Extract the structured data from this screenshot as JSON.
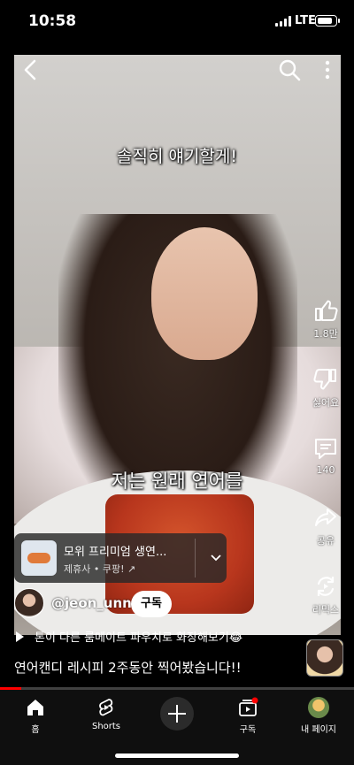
{
  "status_bar": {
    "time": "10:58",
    "network": "LTE",
    "battery_level": 0.85
  },
  "video": {
    "caption_top": "솔직히 얘기할게!",
    "caption_bottom": "저는 원래 연어를"
  },
  "actions": [
    {
      "name": "like",
      "label": "1.8만",
      "icon": "thumbs-up-icon"
    },
    {
      "name": "dislike",
      "label": "싫어요",
      "icon": "thumbs-down-icon"
    },
    {
      "name": "comments",
      "label": "140",
      "icon": "comment-icon"
    },
    {
      "name": "share",
      "label": "공유",
      "icon": "share-icon"
    },
    {
      "name": "remix",
      "label": "리믹스",
      "icon": "remix-icon"
    }
  ],
  "product": {
    "title": "모위 프리미엄 생연...",
    "subtitle": "제휴사 • 쿠팡!"
  },
  "channel": {
    "handle": "@jeon_unni",
    "subscribe_label": "구독"
  },
  "playlist": {
    "text": "톤이 다른 룸메이트 파우치로 화장해보기😂"
  },
  "description": "연어캔디 레시피 2주동안 찍어봤습니다!!",
  "progress": 0.06,
  "bottom_nav": [
    {
      "label": "홈",
      "icon": "home-icon"
    },
    {
      "label": "Shorts",
      "icon": "shorts-icon"
    },
    {
      "label": "",
      "icon": "create-icon"
    },
    {
      "label": "구독",
      "icon": "subscriptions-icon"
    },
    {
      "label": "내 페이지",
      "icon": "profile-avatar-icon"
    }
  ],
  "colors": {
    "accent": "#ff0000",
    "nav_bg": "#0f0f0f"
  }
}
